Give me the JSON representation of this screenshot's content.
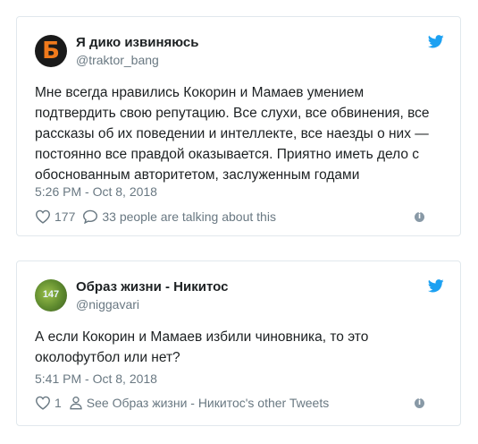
{
  "tweets": [
    {
      "name": "Я дико извиняюсь",
      "handle": "@traktor_bang",
      "avatar_letter": "Б",
      "text": "Мне всегда нравились Кокорин и Мамаев умением подтвердить свою репутацию. Все слухи, все обвинения, все рассказы об их поведении и интеллекте, все наезды о них — постоянно все правдой оказывается. Приятно иметь дело с обоснованным авторитетом, заслуженным годами",
      "time": "5:26 PM - Oct 8, 2018",
      "likes": "177",
      "talking": "33 people are talking about this",
      "icons": [
        "heart-icon",
        "comment-icon",
        "info-icon",
        "twitter-bird-icon"
      ]
    },
    {
      "name": "Образ жизни - Никитос",
      "handle": "@niggavari",
      "avatar_text": "147",
      "text": "А если Кокорин и Мамаев избили чиновника, то это околофутбол или нет?",
      "time": "5:41 PM - Oct 8, 2018",
      "likes": "1",
      "other_tweets": "See Образ жизни - Никитос's other Tweets",
      "icons": [
        "heart-icon",
        "person-icon",
        "info-icon",
        "twitter-bird-icon"
      ]
    }
  ],
  "colors": {
    "accent": "#1da1f2",
    "muted": "#697882",
    "text": "#1c2022",
    "border": "#e1e8ed"
  }
}
